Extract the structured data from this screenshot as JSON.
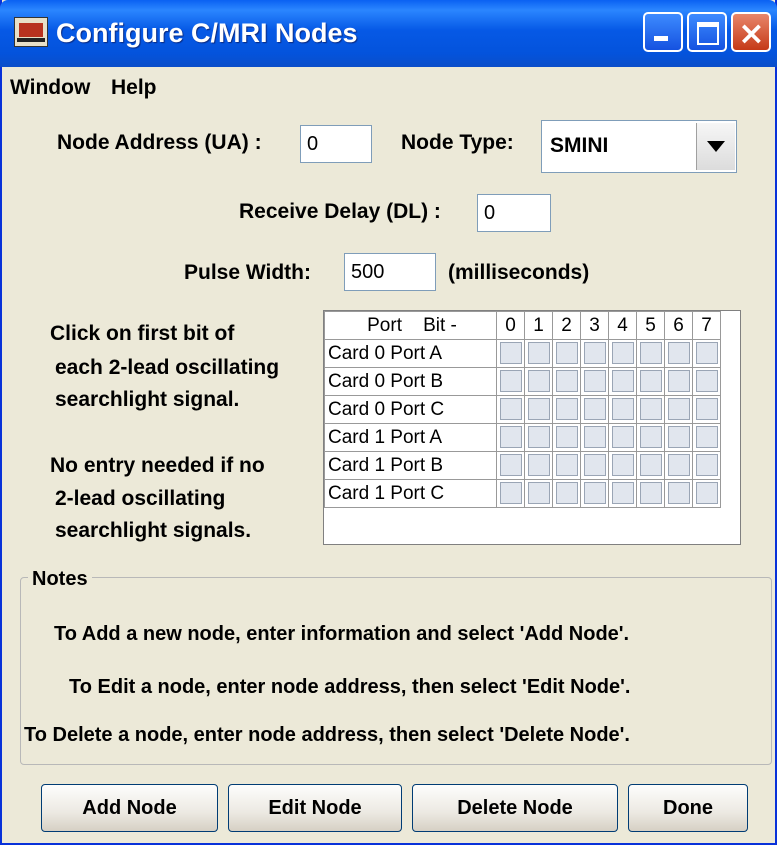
{
  "window": {
    "title": "Configure C/MRI Nodes"
  },
  "menu": [
    "Window",
    "Help"
  ],
  "node_address": {
    "label": "Node Address (UA) :",
    "value": "0"
  },
  "node_type": {
    "label": "Node Type:",
    "value": "SMINI"
  },
  "receive_delay": {
    "label": "Receive Delay (DL) :",
    "value": "0"
  },
  "pulse_width": {
    "label": "Pulse Width:",
    "value": "500",
    "unit": "(milliseconds)"
  },
  "instructions": {
    "line1": "Click on first bit of",
    "line2": "each 2-lead oscillating",
    "line3": "searchlight signal.",
    "line4": "No entry needed if no",
    "line5": "2-lead oscillating",
    "line6": "searchlight signals."
  },
  "bit_table": {
    "header": "Port    Bit -",
    "bits": [
      "0",
      "1",
      "2",
      "3",
      "4",
      "5",
      "6",
      "7"
    ],
    "rows": [
      "Card 0 Port A",
      "Card 0 Port B",
      "Card 0 Port C",
      "Card 1 Port A",
      "Card 1 Port B",
      "Card 1 Port C"
    ]
  },
  "notes": {
    "title": "Notes",
    "items": [
      "To Add a new node, enter information and select 'Add Node'.",
      "To Edit a node, enter node address, then select 'Edit Node'.",
      "To Delete a node, enter node address, then select 'Delete Node'."
    ]
  },
  "buttons": {
    "add": "Add Node",
    "edit": "Edit Node",
    "delete": "Delete Node",
    "done": "Done"
  }
}
